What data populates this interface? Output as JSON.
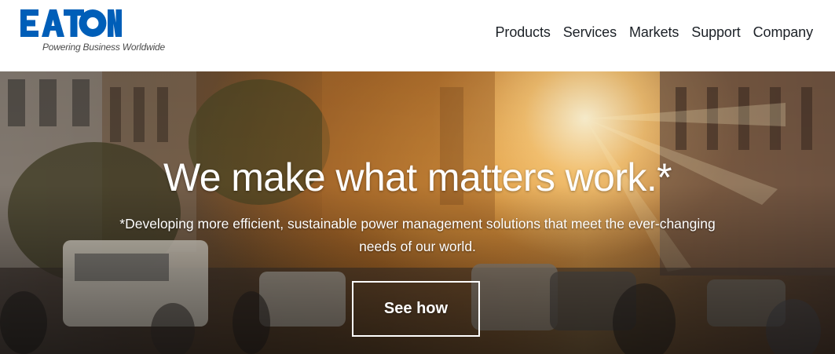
{
  "brand": {
    "logo_text": "EATON",
    "tagline": "Powering Business Worldwide",
    "color": "#005eb8"
  },
  "nav": {
    "items": [
      {
        "label": "Products"
      },
      {
        "label": "Services"
      },
      {
        "label": "Markets"
      },
      {
        "label": "Support"
      },
      {
        "label": "Company"
      }
    ]
  },
  "hero": {
    "title": "We make what matters work.*",
    "subtitle": "*Developing more efficient, sustainable power management solutions that meet the ever-changing needs of our world.",
    "cta_label": "See how",
    "background_image": "city-street-sunset-icon"
  }
}
